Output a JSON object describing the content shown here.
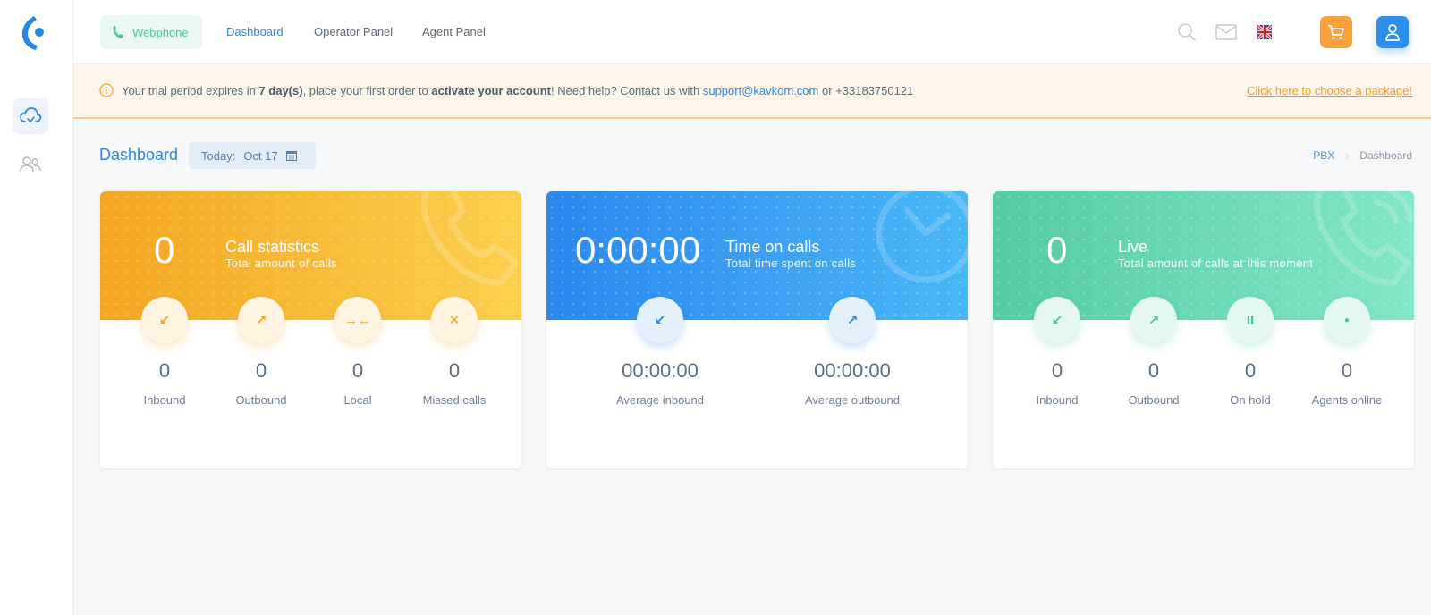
{
  "nav": {
    "webphone_label": "Webphone",
    "links": [
      "Dashboard",
      "Operator Panel",
      "Agent Panel"
    ],
    "active": "Dashboard"
  },
  "banner": {
    "text_1": "Your trial period expires in ",
    "days": "7 day(s)",
    "text_2": ", place your first order to ",
    "activate": "activate your account",
    "text_3": "! Need help? Contact us with ",
    "email": "support@kavkom.com",
    "text_4": " or +33183750121",
    "cta": "Click here to choose a package!"
  },
  "header": {
    "title": "Dashboard",
    "date_label": "Today:",
    "date_value": "Oct 17",
    "breadcrumb": [
      "PBX",
      "Dashboard"
    ]
  },
  "cards": [
    {
      "big": "0",
      "title": "Call statistics",
      "subtitle": "Total amount of calls",
      "stats": [
        {
          "icon": "↙",
          "value": "0",
          "label": "Inbound"
        },
        {
          "icon": "↗",
          "value": "0",
          "label": "Outbound"
        },
        {
          "icon": "→←",
          "value": "0",
          "label": "Local"
        },
        {
          "icon": "✕",
          "value": "0",
          "label": "Missed calls"
        }
      ]
    },
    {
      "big": "0:00:00",
      "title": "Time on calls",
      "subtitle": "Total time spent on calls",
      "stats": [
        {
          "icon": "↙",
          "value": "00:00:00",
          "label": "Average inbound"
        },
        {
          "icon": "↗",
          "value": "00:00:00",
          "label": "Average outbound"
        }
      ]
    },
    {
      "big": "0",
      "title": "Live",
      "subtitle": "Total amount of calls at this moment",
      "stats": [
        {
          "icon": "↙",
          "value": "0",
          "label": "Inbound"
        },
        {
          "icon": "↗",
          "value": "0",
          "label": "Outbound"
        },
        {
          "icon": "II",
          "value": "0",
          "label": "On hold"
        },
        {
          "icon": "●",
          "value": "0",
          "label": "Agents online"
        }
      ]
    }
  ],
  "colors": {
    "accent": "#2b86ea",
    "orange": "#f3a622",
    "blue": "#2b87ef",
    "green": "#55cba4"
  }
}
